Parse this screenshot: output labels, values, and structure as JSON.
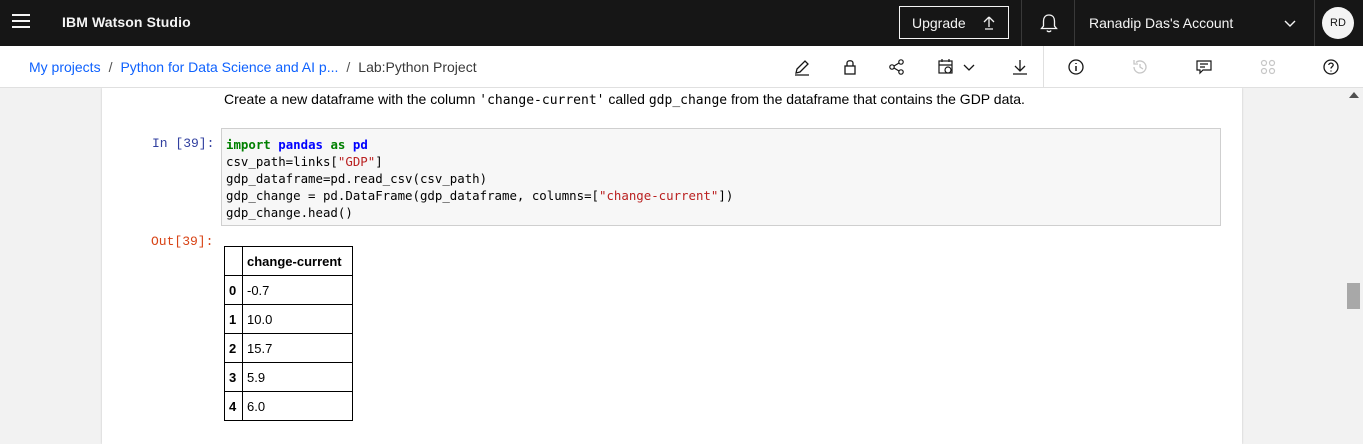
{
  "header": {
    "brand": "IBM Watson Studio",
    "upgrade_label": "Upgrade",
    "account_label": "Ranadip Das's Account",
    "avatar_initials": "RD"
  },
  "breadcrumb": {
    "items": [
      "My projects",
      "Python for Data Science and AI p...",
      "Lab:Python Project"
    ],
    "separator": "/"
  },
  "toolbar": {
    "icons": [
      "edit-icon",
      "lock-icon",
      "share-icon",
      "schedule-icon",
      "chevron-down-icon",
      "download-icon",
      "info-icon",
      "history-icon",
      "comments-icon",
      "assets-icon",
      "help-icon"
    ]
  },
  "notebook": {
    "markdown_before": "Create a new dataframe with the column ",
    "markdown_code": "'change-current'",
    "markdown_middle": " called ",
    "markdown_code2": "gdp_change",
    "markdown_after": " from the dataframe that contains the GDP data.",
    "in_prompt": "In [39]:",
    "out_prompt": "Out[39]:",
    "code": {
      "l1_kw1": "import",
      "l1_nm1": "pandas",
      "l1_kw2": "as",
      "l1_nm2": "pd",
      "l2_a": "csv_path=links[",
      "l2_str": "\"GDP\"",
      "l2_b": "]",
      "l3": "gdp_dataframe=pd.read_csv(csv_path)",
      "l4_a": "gdp_change = pd.DataFrame(gdp_dataframe, columns=[",
      "l4_str": "\"change-current\"",
      "l4_b": "])",
      "l5": "gdp_change.head()"
    },
    "dataframe": {
      "column": "change-current",
      "index": [
        "0",
        "1",
        "2",
        "3",
        "4"
      ],
      "values": [
        "-0.7",
        "10.0",
        "15.7",
        "5.9",
        "6.0"
      ]
    }
  },
  "colors": {
    "topbar_bg": "#161616",
    "link": "#0f62fe",
    "in_prompt": "#303f9f",
    "out_prompt": "#d84315",
    "keyword": "#008000",
    "string": "#ba2121"
  }
}
